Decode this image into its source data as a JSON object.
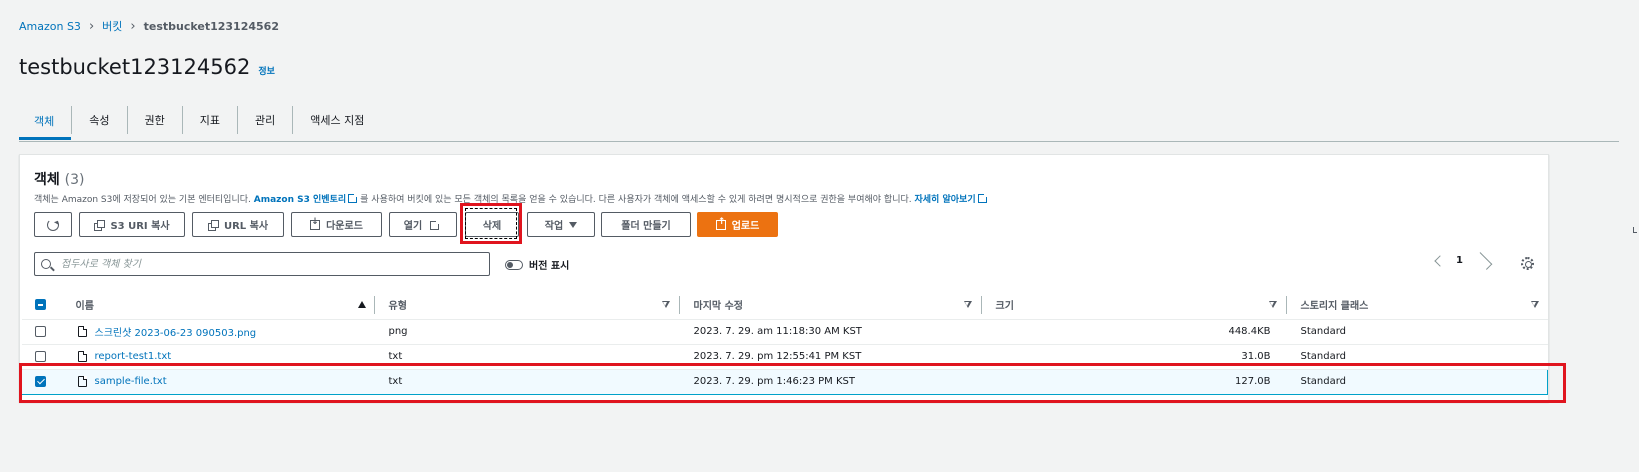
{
  "breadcrumb": {
    "root": "Amazon S3",
    "buckets": "버킷",
    "current": "testbucket123124562"
  },
  "page": {
    "title": "testbucket123124562",
    "info_link": "정보"
  },
  "tabs": [
    "객체",
    "속성",
    "권한",
    "지표",
    "관리",
    "액세스 지점"
  ],
  "objects_panel": {
    "title": "객체",
    "count": "(3)",
    "description_pre": "객체는 Amazon S3에 저장되어 있는 기본 엔터티입니다.",
    "inventory_link": "Amazon S3 인벤토리",
    "description_mid": "를 사용하여 버킷에 있는 모든 객체의 목록을 얻을 수 있습니다. 다른 사용자가 객체에 액세스할 수 있게 하려면 명시적으로 권한을 부여해야 합니다.",
    "learn_more": "자세히 알아보기"
  },
  "toolbar": {
    "copy_s3_uri": "S3 URI 복사",
    "copy_url": "URL 복사",
    "download": "다운로드",
    "open": "열기",
    "delete": "삭제",
    "actions": "작업",
    "create_folder": "폴더 만들기",
    "upload": "업로드"
  },
  "search": {
    "placeholder": "접두사로 객체 찾기"
  },
  "versions_toggle": "버전 표시",
  "pagination": {
    "current_page": "1"
  },
  "table": {
    "columns": [
      "이름",
      "유형",
      "마지막 수정",
      "크기",
      "스토리지 클래스"
    ],
    "rows": [
      {
        "name": "스크린샷 2023-06-23 090503.png",
        "type": "png",
        "modified": "2023. 7. 29. am 11:18:30 AM KST",
        "size": "448.4KB",
        "storage": "Standard",
        "checked": false
      },
      {
        "name": "report-test1.txt",
        "type": "txt",
        "modified": "2023. 7. 29. pm 12:55:41 PM KST",
        "size": "31.0B",
        "storage": "Standard",
        "checked": false
      },
      {
        "name": "sample-file.txt",
        "type": "txt",
        "modified": "2023. 7. 29. pm 1:46:23 PM KST",
        "size": "127.0B",
        "storage": "Standard",
        "checked": true
      }
    ]
  },
  "colors": {
    "link": "#0073bb",
    "primary_button": "#ec7211",
    "highlight": "#e0141e",
    "selected_row": "#f1faff"
  }
}
